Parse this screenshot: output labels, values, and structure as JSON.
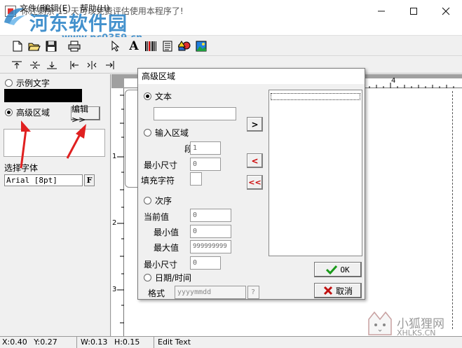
{
  "window": {
    "title": "你还剩余 15 天可以免费评估使用本程序了!",
    "minimize_icon": "minimize-icon",
    "maximize_icon": "maximize-icon",
    "close_icon": "close-icon"
  },
  "watermark": {
    "brand": "河东软件园",
    "url": "www.pc0359.cn",
    "corner_cn": "小狐狸网",
    "corner_en": "XHLKS.CN"
  },
  "menu": {
    "file": "文件(F)",
    "edit": "编辑(E)",
    "help": "帮助(H)"
  },
  "toolbar1": {
    "icons": [
      "new-doc-icon",
      "open-folder-icon",
      "save-disk-icon",
      "print-icon",
      "pointer-icon",
      "text-tool-icon",
      "barcode-icon",
      "document-icon",
      "shapes-icon",
      "image-icon"
    ],
    "text_glyph": "A"
  },
  "toolbar2": {
    "icons": [
      "align-top-icon",
      "align-middle-icon",
      "align-bottom-icon",
      "align-left-icon",
      "align-center-icon",
      "align-right-icon"
    ]
  },
  "left_panel": {
    "sample_text_label": "示例文字",
    "advanced_area_label": "高级区域",
    "edit_button": "编辑>>",
    "select_font_label": "选择字体",
    "font_value": "Arial [8pt]",
    "font_button": "F"
  },
  "ruler": {
    "top_marks": [
      "4"
    ],
    "left_marks": [
      "1",
      "2",
      "3"
    ]
  },
  "dialog": {
    "title": "高级区域",
    "text_option": "文本",
    "text_value": "",
    "input_area_option": "输入区域",
    "paragraph_label": "段落 #",
    "paragraph_value": "1",
    "min_size_label": "最小尺寸",
    "min_size_value": "0",
    "fill_char_label": "填充字符",
    "fill_char_value": "",
    "sequence_option": "次序",
    "current_value_label": "当前值",
    "current_value": "0",
    "min_value_label": "最小值",
    "min_value": "0",
    "max_value_label": "最大值",
    "max_value": "999999999",
    "seq_min_size_label": "最小尺寸",
    "seq_min_size_value": "0",
    "datetime_option": "日期/时间",
    "format_label": "格式",
    "format_value": "yyyymmdd",
    "format_help": "?",
    "nav_add": ">",
    "nav_remove": "<",
    "nav_remove_all": "<<",
    "ok_label": "OK",
    "cancel_label": "取消"
  },
  "status": {
    "x": "X:0.40",
    "y": "Y:0.27",
    "w": "W:0.13",
    "h": "H:0.15",
    "mode": "Edit Text"
  },
  "colors": {
    "accent_red": "#e02020",
    "watermark_blue": "#2f86c8"
  }
}
